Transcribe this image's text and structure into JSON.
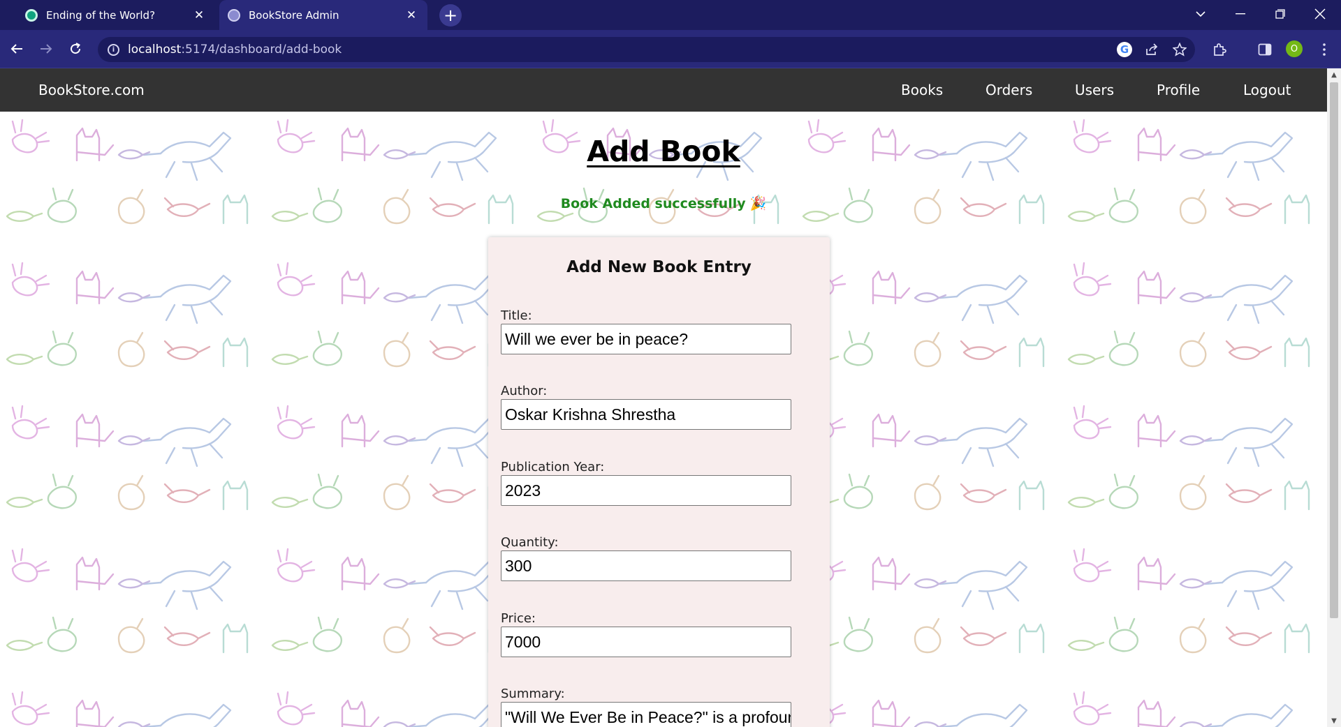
{
  "browser": {
    "tabs": [
      {
        "label": "Ending of the World?",
        "active": false
      },
      {
        "label": "BookStore Admin",
        "active": true
      }
    ],
    "url_host": "localhost",
    "url_path": ":5174/dashboard/add-book",
    "profile_initial": "O"
  },
  "navbar": {
    "brand": "BookStore.com",
    "links": [
      "Books",
      "Orders",
      "Users",
      "Profile",
      "Logout"
    ]
  },
  "main": {
    "title": "Add Book",
    "success_message": "Book Added successfully",
    "success_emoji": "🎉"
  },
  "form": {
    "heading": "Add New Book Entry",
    "fields": [
      {
        "label": "Title:",
        "value": "Will we ever be in peace?"
      },
      {
        "label": "Author:",
        "value": "Oskar Krishna Shrestha"
      },
      {
        "label": "Publication Year:",
        "value": "2023"
      },
      {
        "label": "Quantity:",
        "value": "300"
      },
      {
        "label": "Price:",
        "value": "7000"
      },
      {
        "label": "Summary:",
        "value": "\"Will We Ever Be in Peace?\" is a profound"
      }
    ]
  },
  "colors": {
    "tabstrip": "#1c1c5e",
    "toolbar": "#29297a",
    "navbar": "#333333",
    "success": "#1f8a1f",
    "card": "#f8eded"
  }
}
